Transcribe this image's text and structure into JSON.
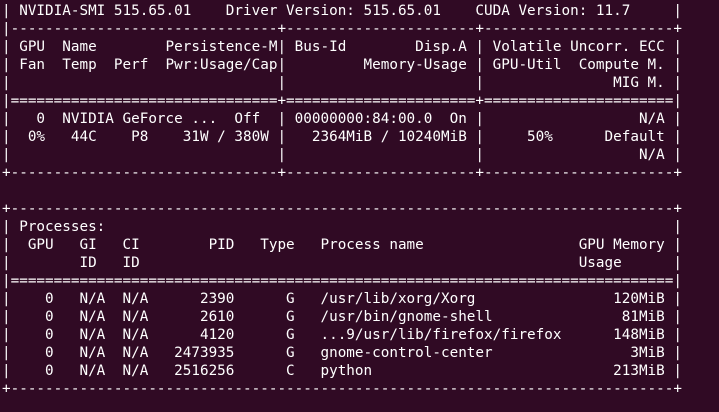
{
  "terminal": {
    "background": "#300a24",
    "foreground": "#ffffff",
    "lines": [
      "| NVIDIA-SMI 515.65.01    Driver Version: 515.65.01    CUDA Version: 11.7     |",
      "|-------------------------------+----------------------+----------------------+",
      "| GPU  Name        Persistence-M| Bus-Id        Disp.A | Volatile Uncorr. ECC |",
      "| Fan  Temp  Perf  Pwr:Usage/Cap|         Memory-Usage | GPU-Util  Compute M. |",
      "|                               |                      |               MIG M. |",
      "|===============================+======================+======================|",
      "|   0  NVIDIA GeForce ...  Off  | 00000000:84:00.0  On |                  N/A |",
      "|  0%   44C    P8    31W / 380W |   2364MiB / 10240MiB |     50%      Default |",
      "|                               |                      |                  N/A |",
      "+-------------------------------+----------------------+----------------------+",
      "",
      "+-----------------------------------------------------------------------------+",
      "| Processes:                                                                  |",
      "|  GPU   GI   CI        PID   Type   Process name                  GPU Memory |",
      "|        ID   ID                                                   Usage      |",
      "|=============================================================================|",
      "|    0   N/A  N/A      2390      G   /usr/lib/xorg/Xorg                120MiB |",
      "|    0   N/A  N/A      2610      G   /usr/bin/gnome-shell               81MiB |",
      "|    0   N/A  N/A      4120      G   ...9/usr/lib/firefox/firefox      148MiB |",
      "|    0   N/A  N/A   2473935      G   gnome-control-center                3MiB |",
      "|    0   N/A  N/A   2516256      C   python                            213MiB |",
      "+-----------------------------------------------------------------------------+"
    ]
  }
}
